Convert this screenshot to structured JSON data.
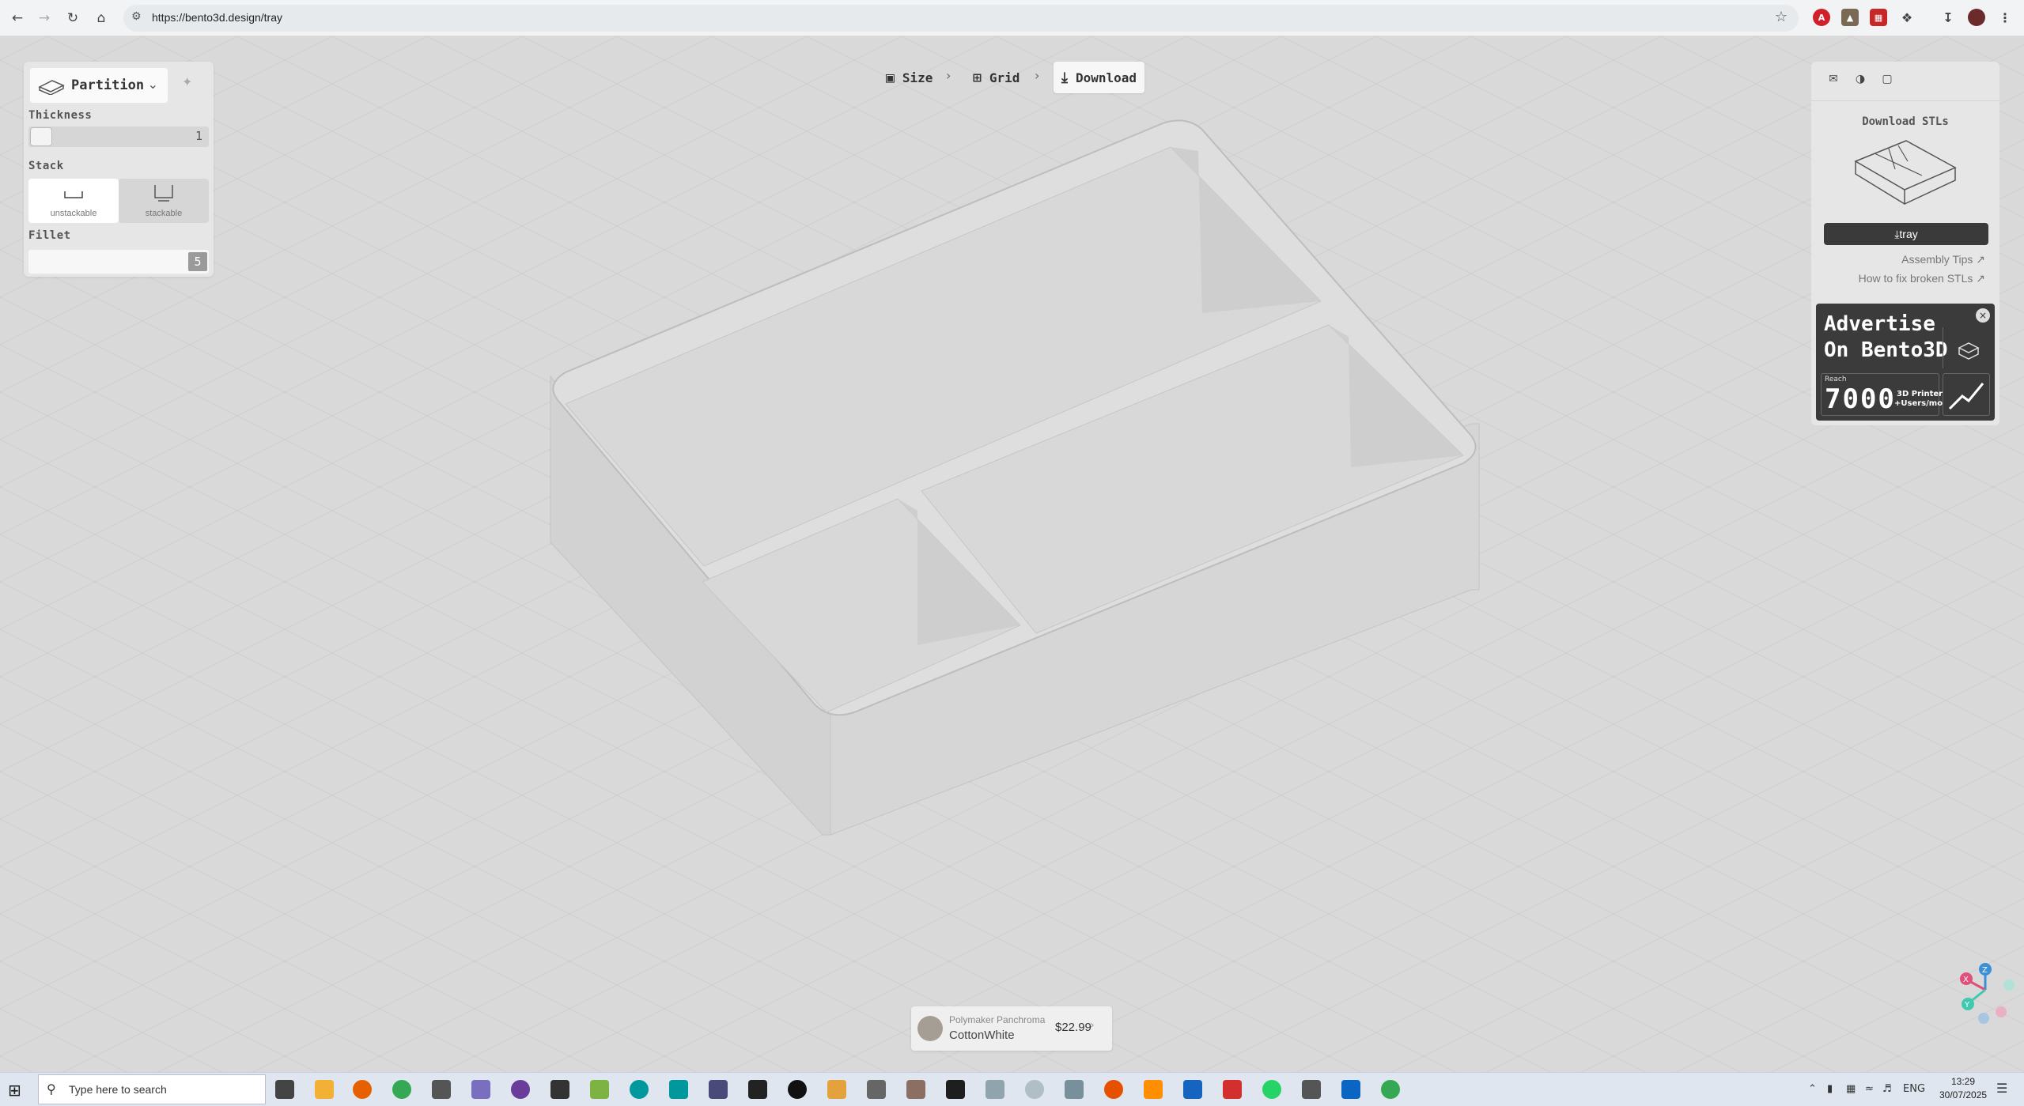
{
  "browser": {
    "url": "https://bento3d.design/tray",
    "nav": {
      "back": "back-icon",
      "forward": "forward-icon",
      "reload": "reload-icon",
      "home": "home-icon"
    }
  },
  "left_panel": {
    "part": "Partition",
    "thickness_label": "Thickness",
    "thickness_value": "1",
    "stack_label": "Stack",
    "stack_options": [
      "unstackable",
      "stackable"
    ],
    "stack_selected": "unstackable",
    "fillet_label": "Fillet",
    "fillet_value": "5"
  },
  "stepper": {
    "steps": [
      "Size",
      "Grid",
      "Download"
    ],
    "active": "Download"
  },
  "right_panel": {
    "title": "Download STLs",
    "tray_button": "tray",
    "links": [
      "Assembly Tips",
      "How to fix broken STLs"
    ],
    "ad": {
      "title": "Advertise\nOn Bento3D",
      "reach_label": "Reach",
      "reach_value": "7000",
      "reach_unit_line1": "3D Printer",
      "reach_unit_line2": "+Users/mo"
    }
  },
  "filament": {
    "brand": "Polymaker Panchroma",
    "color": "CottonWhite",
    "price": "$22.99"
  },
  "taskbar": {
    "search_placeholder": "Type here to search",
    "lang": "ENG",
    "time": "13:29",
    "date": "30/07/2025"
  },
  "axes_gizmo": {
    "x": "X",
    "y": "Y",
    "z": "Z"
  },
  "colors": {
    "background": "#d9d9d9",
    "panel": "#e6e6e6",
    "dark_button": "#3a3a3a",
    "gizmo_x": "#e0507a",
    "gizmo_y": "#41c9b0",
    "gizmo_z": "#3a8fd6"
  }
}
